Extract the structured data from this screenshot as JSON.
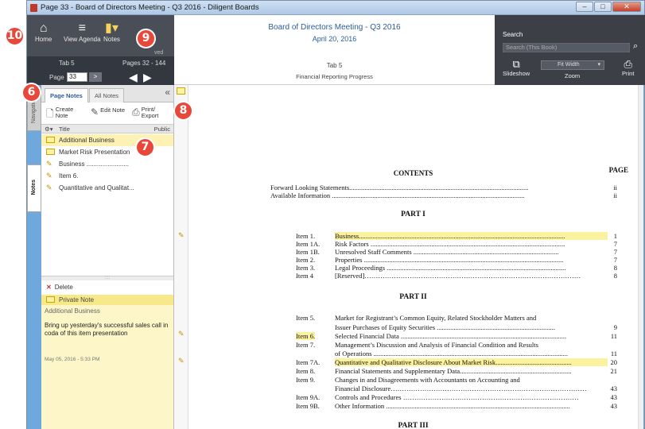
{
  "window": {
    "title": "Page 33 - Board of Directors Meeting - Q3 2016 - Diligent Boards",
    "minimize": "–",
    "maximize": "□",
    "close": "✕"
  },
  "toolbar": {
    "home": "Home",
    "view_agenda": "View Agenda",
    "notes": "Notes",
    "viewed_fragment": "ved",
    "tab": "Tab 5",
    "page_label": "Page",
    "page_value": "33",
    "go": ">",
    "pages_range": "Pages 32 - 144",
    "prev": "◀",
    "next": "▶"
  },
  "header": {
    "meeting_title": "Board of Directors Meeting - Q3 2016",
    "meeting_date": "April 20, 2016",
    "tab_title": "Tab 5",
    "tab_subtitle": "Financial Reporting Progress"
  },
  "right_tools": {
    "search_label": "Search",
    "search_placeholder": "Search (This Book)",
    "slideshow": "Slideshow",
    "zoom_label": "Zoom",
    "zoom_value": "Fit Width",
    "print": "Print"
  },
  "side_tabs": {
    "navigation": "Navigation",
    "notes": "Notes"
  },
  "notes_panel": {
    "tab_page_notes": "Page Notes",
    "tab_all_notes": "All Notes",
    "collapse": "«",
    "create_note": "Create\nNote",
    "edit_note": "Edit Note",
    "print_export": "Print/\nExport",
    "col_title": "Title",
    "col_public": "Public",
    "items": [
      {
        "label": "Additional Business",
        "kind": "note"
      },
      {
        "label": "Market Risk Presentation",
        "kind": "note"
      },
      {
        "label": "Business ........................",
        "kind": "annotation"
      },
      {
        "label": "Item 6.",
        "kind": "annotation"
      },
      {
        "label": "Quantitative and Qualitat...",
        "kind": "annotation"
      }
    ],
    "splitter": "::::",
    "delete": "Delete",
    "private_note": "Private Note",
    "detail_title": "Additional Business",
    "detail_body": "Bring up yesterday's successful sales call in coda of this item presentation",
    "detail_date": "May 05, 2016 - 5:33 PM"
  },
  "document": {
    "contents": "CONTENTS",
    "page_heading": "PAGE",
    "preamble": [
      {
        "text": "Forward Looking Statements..........................................................................................................",
        "page": "ii"
      },
      {
        "text": "Available Information ..................................................................................................................",
        "page": "ii"
      }
    ],
    "part1": "PART I",
    "part1_items": [
      {
        "num": "Item 1.",
        "text": "Business..........................................................................................................................",
        "page": "1",
        "highlight": true
      },
      {
        "num": "Item 1A.",
        "text": "Risk Factors ...................................................................................................................",
        "page": "7",
        "highlight": false
      },
      {
        "num": "Item 1B.",
        "text": "Unresolved Staff Comments ......................................................................................",
        "page": "7",
        "highlight": false
      },
      {
        "num": "Item 2.",
        "text": "Properties ......................................................................................................................",
        "page": "7",
        "highlight": false
      },
      {
        "num": "Item 3.",
        "text": "Legal Proceedings ..........................................................................................................",
        "page": "8",
        "highlight": false
      },
      {
        "num": "Item 4",
        "text": "[Reserved]……………………………………………………………………………………",
        "page": "8",
        "highlight": false
      }
    ],
    "part2": "PART II",
    "part2_items": [
      {
        "num": "Item 5.",
        "text": "Market for Registrant’s Common Equity, Related Stockholder Matters and",
        "page": "",
        "highlight": false
      },
      {
        "num": "",
        "text": "Issuer Purchases of Equity Securities ......................................................................",
        "page": "9",
        "highlight": false
      },
      {
        "num": "Item 6.",
        "text": "Selected Financial Data ..................................................................................................",
        "page": "11",
        "highlight": false,
        "num_highlight": true
      },
      {
        "num": "Item 7.",
        "text": "Management’s Discussion and Analysis of Financial Condition and Results",
        "page": "",
        "highlight": false
      },
      {
        "num": "",
        "text": "of Operations ...................................................................................................................",
        "page": "11",
        "highlight": false
      },
      {
        "num": "Item 7A.",
        "text": "Quantitative and Qualitative Disclosure About Market Risk.............................................",
        "page": "20",
        "highlight": true
      },
      {
        "num": "Item 8.",
        "text": "Financial Statements and Supplementary Data..................................................................",
        "page": "21",
        "highlight": false
      },
      {
        "num": "Item 9.",
        "text": "Changes in and Disagreements with Accountants on Accounting and",
        "page": "",
        "highlight": false
      },
      {
        "num": "",
        "text": "Financial Disclosure……………………………………………………………………………",
        "page": "43",
        "highlight": false
      },
      {
        "num": "Item 9A.",
        "text": "Controls and Procedures ……………………………………………………………………",
        "page": "43",
        "highlight": false
      },
      {
        "num": "Item 9B.",
        "text": "Other Information .............................................................................................................",
        "page": "43",
        "highlight": false
      }
    ],
    "part3": "PART III"
  },
  "callouts": [
    "10",
    "9",
    "6",
    "8",
    "7"
  ]
}
